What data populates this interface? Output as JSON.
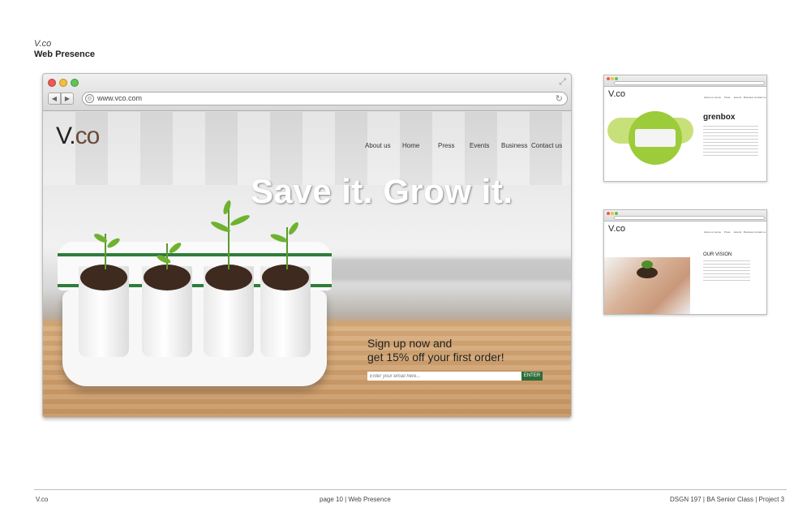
{
  "document": {
    "brand": "V.co",
    "section": "Web Presence",
    "footer_left": "V.co",
    "footer_center": "page 10  | Web Presence",
    "footer_right": "DSGN 197 | BA Senior Class | Project 3"
  },
  "browser": {
    "url": "www.vco.com",
    "back_icon": "◀",
    "forward_icon": "▶",
    "reload_icon": "↻",
    "expand_icon": "⤢"
  },
  "site": {
    "logo_main": "V.",
    "logo_accent": "co",
    "nav": [
      "About us",
      "Home",
      "Press",
      "Events",
      "Business",
      "Contact us"
    ],
    "headline": "Save it. Grow it.",
    "signup_line1": "Sign up now and",
    "signup_line2": "get 15% off your first order!",
    "email_placeholder": "Enter your email here...",
    "enter_label": "ENTER"
  },
  "thumbnails": [
    {
      "logo": "V.co",
      "product_title": "grenbox",
      "nav": [
        "About us",
        "Home",
        "Press",
        "Events",
        "Business",
        "Contact us"
      ]
    },
    {
      "logo": "V.co",
      "section_title": "OUR VISION",
      "nav": [
        "About us",
        "Home",
        "Press",
        "Events",
        "Business",
        "Contact us"
      ]
    }
  ],
  "colors": {
    "accent_green": "#2e6b3a",
    "lime": "#9ccc3a",
    "text_dark": "#222222"
  }
}
